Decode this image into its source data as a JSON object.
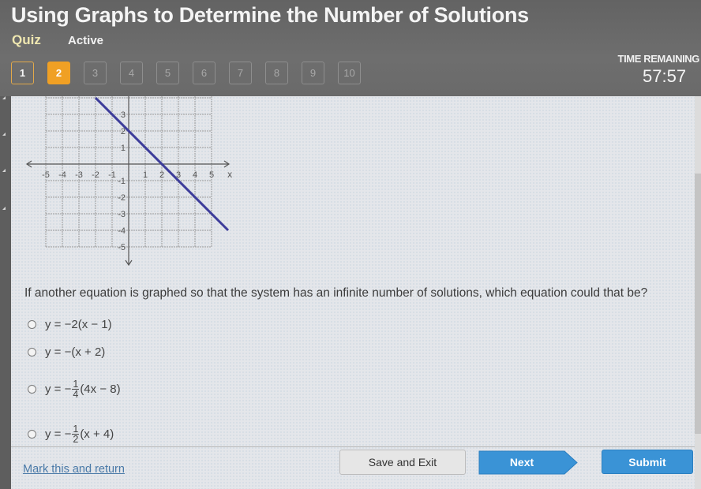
{
  "header": {
    "title": "Using Graphs to Determine the Number of Solutions",
    "quiz_label": "Quiz",
    "status": "Active",
    "time_remaining_label": "TIME REMAINING",
    "time_remaining_value": "57:57"
  },
  "question_nav": {
    "current": 2,
    "items": [
      {
        "label": "1",
        "state": "visited"
      },
      {
        "label": "2",
        "state": "current"
      },
      {
        "label": "3",
        "state": "unvisited"
      },
      {
        "label": "4",
        "state": "unvisited"
      },
      {
        "label": "5",
        "state": "unvisited"
      },
      {
        "label": "6",
        "state": "unvisited"
      },
      {
        "label": "7",
        "state": "unvisited"
      },
      {
        "label": "8",
        "state": "unvisited"
      },
      {
        "label": "9",
        "state": "unvisited"
      },
      {
        "label": "10",
        "state": "unvisited"
      }
    ]
  },
  "graph": {
    "x_axis_label": "x",
    "x_ticks": [
      "-5",
      "-4",
      "-3",
      "-2",
      "-1",
      "1",
      "2",
      "3",
      "4",
      "5"
    ],
    "y_ticks_pos": [
      "1",
      "2",
      "3"
    ],
    "y_ticks_neg": [
      "-1",
      "-2",
      "-3",
      "-4",
      "-5"
    ],
    "x_range": [
      -5,
      5
    ],
    "y_range": [
      -5,
      4
    ],
    "line": {
      "slope": -1,
      "intercept": 2,
      "x_start": -2,
      "x_end": 6,
      "color": "#3d3c9a"
    }
  },
  "question": {
    "text": "If another equation is graphed so that the system has an infinite number of solutions, which equation could that be?",
    "options": [
      {
        "pre": "y = −2(x − 1)",
        "frac": null,
        "post": ""
      },
      {
        "pre": "y = −(x + 2)",
        "frac": null,
        "post": ""
      },
      {
        "pre": "y = −",
        "frac": {
          "num": "1",
          "den": "4"
        },
        "post": "(4x − 8)"
      },
      {
        "pre": "y = −",
        "frac": {
          "num": "1",
          "den": "2"
        },
        "post": "(x + 4)"
      }
    ]
  },
  "footer": {
    "mark_link": "Mark this and return",
    "save_exit": "Save and Exit",
    "next": "Next",
    "submit": "Submit"
  },
  "colors": {
    "accent_orange": "#f0a024",
    "button_blue": "#3a93d6",
    "link_blue": "#4a7aa8"
  }
}
